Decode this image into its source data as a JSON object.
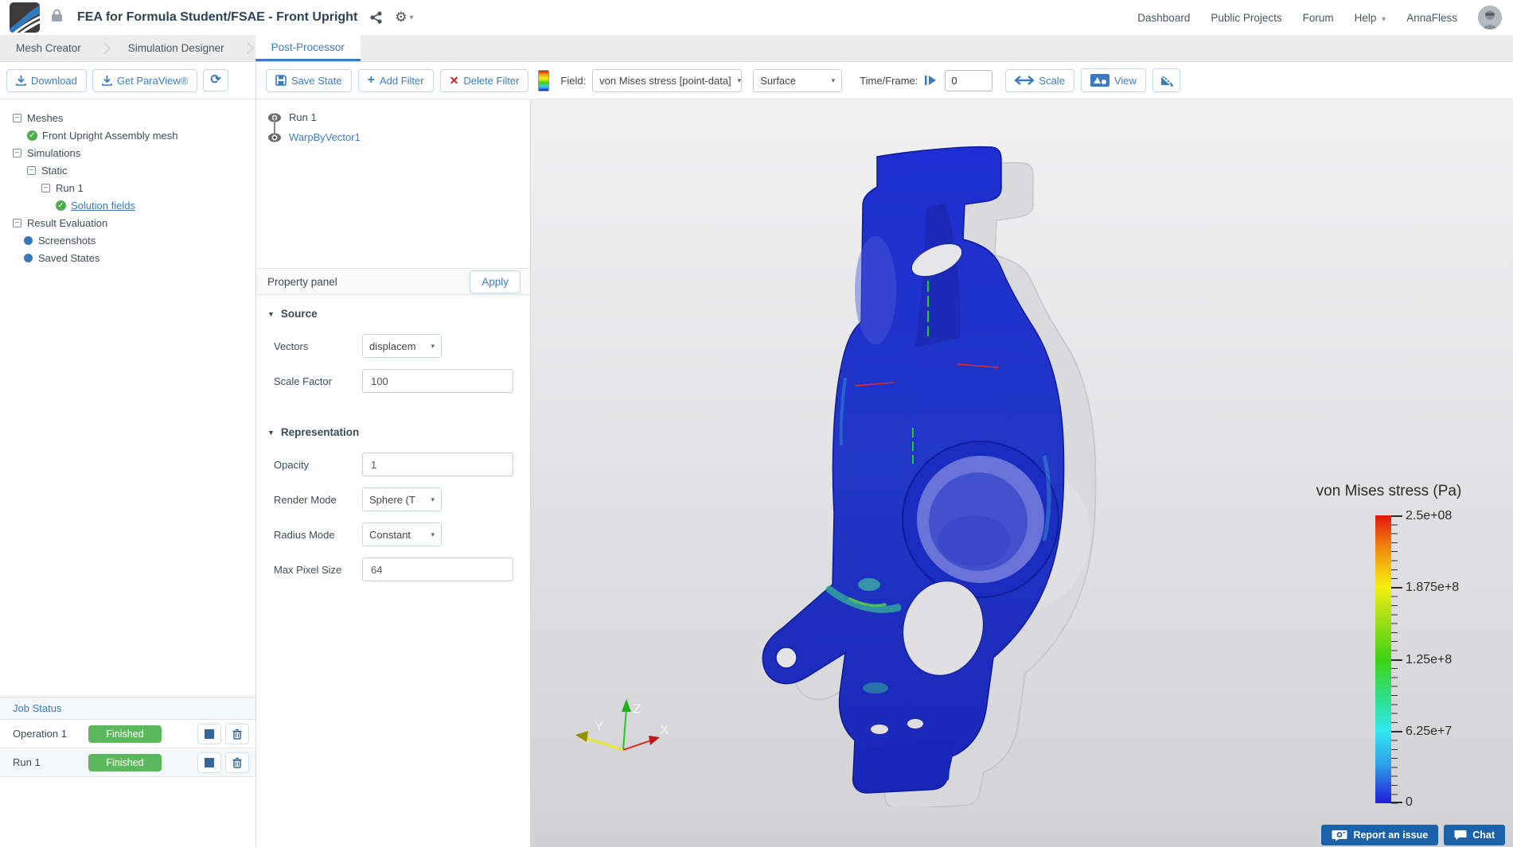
{
  "topbar": {
    "title": "FEA for Formula Student/FSAE - Front Upright",
    "nav": {
      "dashboard": "Dashboard",
      "public_projects": "Public Projects",
      "forum": "Forum",
      "help": "Help"
    },
    "username": "AnnaFless"
  },
  "tabs": {
    "mesh_creator": "Mesh Creator",
    "simulation_designer": "Simulation Designer",
    "post_processor": "Post-Processor"
  },
  "left_panel": {
    "download_label": "Download",
    "get_paraview_label": "Get ParaView®",
    "tree": {
      "meshes": "Meshes",
      "mesh_item": "Front Upright Assembly mesh",
      "simulations": "Simulations",
      "static": "Static",
      "run": "Run 1",
      "solution_fields": "Solution fields",
      "result_evaluation": "Result Evaluation",
      "screenshots": "Screenshots",
      "saved_states": "Saved States"
    },
    "job_status": {
      "title": "Job Status",
      "jobs": [
        {
          "name": "Operation 1",
          "status": "Finished"
        },
        {
          "name": "Run 1",
          "status": "Finished"
        }
      ]
    }
  },
  "toolbar": {
    "save_state": "Save State",
    "add_filter": "Add Filter",
    "delete_filter": "Delete Filter",
    "field_label": "Field:",
    "field_value": "von Mises stress [point-data]",
    "display_mode": "Surface",
    "time_frame_label": "Time/Frame:",
    "time_frame_value": "0",
    "scale": "Scale",
    "view": "View"
  },
  "pipeline": [
    {
      "name": "Run 1"
    },
    {
      "name": "WarpByVector1"
    }
  ],
  "property_panel": {
    "title": "Property panel",
    "apply": "Apply",
    "source": {
      "title": "Source",
      "vectors_label": "Vectors",
      "vectors_value": "displacem",
      "scale_factor_label": "Scale Factor",
      "scale_factor_value": "100"
    },
    "representation": {
      "title": "Representation",
      "opacity_label": "Opacity",
      "opacity_value": "1",
      "render_mode_label": "Render Mode",
      "render_mode_value": "Sphere (T",
      "radius_mode_label": "Radius Mode",
      "radius_mode_value": "Constant",
      "max_pixel_label": "Max Pixel Size",
      "max_pixel_value": "64"
    }
  },
  "viewport": {
    "colorbar": {
      "title": "von Mises stress (Pa)",
      "ticks": [
        "2.5e+08",
        "1.875e+8",
        "1.25e+8",
        "6.25e+7",
        "0"
      ],
      "color_top": "#e3170d",
      "color_bottom": "#1f1bd8"
    },
    "axes": {
      "x": "X",
      "y": "Y",
      "z": "Z"
    },
    "report_issue": "Report an issue",
    "chat": "Chat"
  },
  "glyphs": {
    "minus": "−",
    "check": "✓",
    "plus": "+",
    "close_x": "✕",
    "refresh": "⟳",
    "caret_down": "▾",
    "gear": "⚙",
    "section_tri": "▼"
  }
}
